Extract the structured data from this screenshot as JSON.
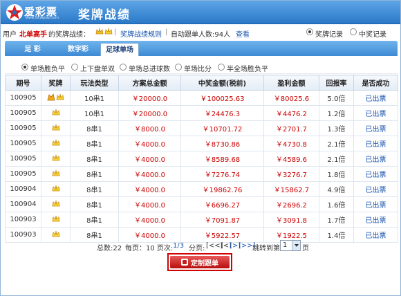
{
  "app": {
    "logo_text": "爱彩票",
    "logo_url": "www.5icaipiao.com",
    "title": "奖牌战绩"
  },
  "info": {
    "prefix": "用户",
    "username": "北单高手",
    "suffix": "的奖牌战绩：",
    "rules_link": "奖牌战绩规则",
    "follow_label": "自动跟单人数:94人",
    "view_link": "查看",
    "radio_record": "奖牌记录",
    "radio_win": "中奖记录"
  },
  "tabs": [
    "足 彩",
    "数字彩",
    "足球单场"
  ],
  "subopts": [
    "单场胜负平",
    "上下盘单双",
    "单场总进球数",
    "单场比分",
    "半全场胜负平"
  ],
  "table": {
    "headers": [
      "期号",
      "奖牌",
      "玩法类型",
      "方案总金额",
      "中奖金额(税前)",
      "盈利金额",
      "回报率",
      "是否成功"
    ],
    "rows": [
      {
        "period": "100905",
        "award": [
          "gold-icon",
          "crown-icon"
        ],
        "type": "10串1",
        "total": "￥20000.0",
        "win": "￥100025.63",
        "profit": "￥80025.6",
        "rate": "5.0倍",
        "status": "已出票"
      },
      {
        "period": "100905",
        "award": [
          "crown-icon"
        ],
        "type": "10串1",
        "total": "￥20000.0",
        "win": "￥24476.3",
        "profit": "￥4476.2",
        "rate": "1.2倍",
        "status": "已出票"
      },
      {
        "period": "100905",
        "award": [
          "crown-icon"
        ],
        "type": "8串1",
        "total": "￥8000.0",
        "win": "￥10701.72",
        "profit": "￥2701.7",
        "rate": "1.3倍",
        "status": "已出票"
      },
      {
        "period": "100905",
        "award": [
          "crown-icon"
        ],
        "type": "8串1",
        "total": "￥4000.0",
        "win": "￥8730.86",
        "profit": "￥4730.8",
        "rate": "2.1倍",
        "status": "已出票"
      },
      {
        "period": "100905",
        "award": [
          "crown-icon"
        ],
        "type": "8串1",
        "total": "￥4000.0",
        "win": "￥8589.68",
        "profit": "￥4589.6",
        "rate": "2.1倍",
        "status": "已出票"
      },
      {
        "period": "100905",
        "award": [
          "crown-icon"
        ],
        "type": "8串1",
        "total": "￥4000.0",
        "win": "￥7276.74",
        "profit": "￥3276.7",
        "rate": "1.8倍",
        "status": "已出票"
      },
      {
        "period": "100904",
        "award": [
          "crown-icon"
        ],
        "type": "8串1",
        "total": "￥4000.0",
        "win": "￥19862.76",
        "profit": "￥15862.7",
        "rate": "4.9倍",
        "status": "已出票"
      },
      {
        "period": "100904",
        "award": [
          "crown-icon"
        ],
        "type": "8串1",
        "total": "￥4000.0",
        "win": "￥6696.27",
        "profit": "￥2696.2",
        "rate": "1.6倍",
        "status": "已出票"
      },
      {
        "period": "100903",
        "award": [
          "crown-icon"
        ],
        "type": "8串1",
        "total": "￥4000.0",
        "win": "￥7091.87",
        "profit": "￥3091.8",
        "rate": "1.7倍",
        "status": "已出票"
      },
      {
        "period": "100903",
        "award": [
          "crown-icon"
        ],
        "type": "8串1",
        "total": "￥4000.0",
        "win": "￥5922.57",
        "profit": "￥1922.5",
        "rate": "1.4倍",
        "status": "已出票"
      }
    ]
  },
  "pager": {
    "total": "总数:22",
    "per_page": "每页：10 页次:",
    "page_now": "1/3",
    "paging_label": "分页:",
    "nav": [
      "[<<]",
      "[<]",
      "[>]",
      "[>>]"
    ],
    "jump_label": "跳转到第",
    "jump_value": "1",
    "page_unit": "页"
  },
  "custom_button": "定制跟单",
  "colors": {
    "brand_blue": "#2a78c8",
    "money_red": "#cc0000",
    "link_blue": "#1a55b0"
  }
}
